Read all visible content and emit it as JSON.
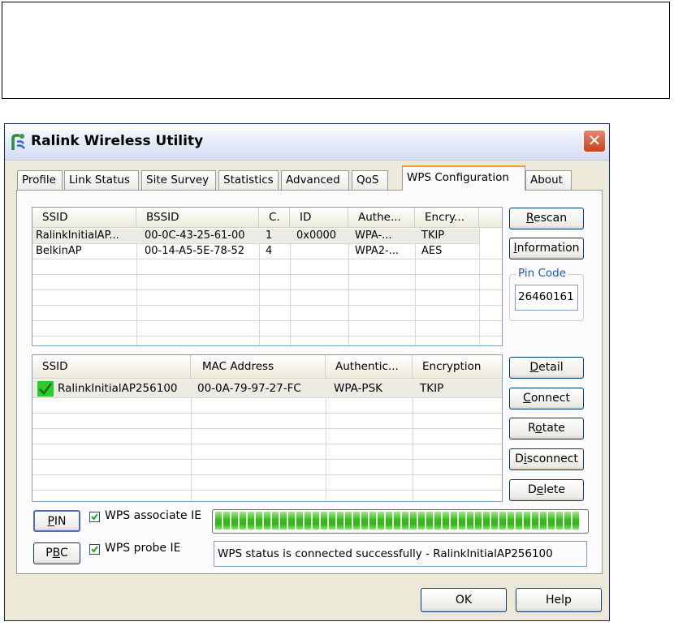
{
  "window": {
    "title": "Ralink Wireless Utility",
    "close_glyph": "✕"
  },
  "tabs": [
    {
      "label": "Profile"
    },
    {
      "label": "Link Status"
    },
    {
      "label": "Site Survey"
    },
    {
      "label": "Statistics"
    },
    {
      "label": "Advanced"
    },
    {
      "label": "QoS"
    },
    {
      "label": "WPS Configuration"
    },
    {
      "label": "About"
    }
  ],
  "ap_list": {
    "columns": [
      "SSID",
      "BSSID",
      "C.",
      "ID",
      "Authe...",
      "Encry..."
    ],
    "rows": [
      {
        "ssid": "RalinkInitialAP...",
        "bssid": "00-0C-43-25-61-00",
        "channel": "1",
        "id": "0x0000",
        "auth": "WPA-...",
        "encry": "TKIP"
      },
      {
        "ssid": "BelkinAP",
        "bssid": "00-14-A5-5E-78-52",
        "channel": "4",
        "id": "",
        "auth": "WPA2-...",
        "encry": "AES"
      }
    ]
  },
  "profile_list": {
    "columns": [
      "SSID",
      "MAC Address",
      "Authentic...",
      "Encryption"
    ],
    "rows": [
      {
        "ssid": "RalinkInitialAP256100",
        "mac": "00-0A-79-97-27-FC",
        "auth": "WPA-PSK",
        "encryption": "TKIP",
        "connected": true
      }
    ]
  },
  "buttons": {
    "rescan": {
      "prefix": "",
      "hot": "R",
      "rest": "escan"
    },
    "information": {
      "prefix": "",
      "hot": "I",
      "rest": "nformation"
    },
    "detail": {
      "prefix": "",
      "hot": "D",
      "rest": "etail"
    },
    "connect": {
      "prefix": "",
      "hot": "C",
      "rest": "onnect"
    },
    "rotate": {
      "prefix": "R",
      "hot": "o",
      "rest": "tate"
    },
    "disconnect": {
      "prefix": "D",
      "hot": "i",
      "rest": "sconnect"
    },
    "delete": {
      "prefix": "D",
      "hot": "e",
      "rest": "lete"
    },
    "pin": {
      "prefix": "",
      "hot": "P",
      "rest": "IN"
    },
    "pbc": {
      "prefix": "P",
      "hot": "B",
      "rest": "C"
    },
    "ok": "OK",
    "help": "Help"
  },
  "pin_code": {
    "label": "Pin Code",
    "value": "26460161"
  },
  "checkboxes": {
    "associate": {
      "label": "WPS associate IE",
      "checked": true
    },
    "probe": {
      "label": "WPS probe IE",
      "checked": true
    }
  },
  "progress": {
    "value": 1.0
  },
  "status_text": "WPS status is connected successfully - RalinkInitialAP256100",
  "colors": {
    "accent_tab": "#f2a02a",
    "progress_green": "#31c016",
    "close_red": "#c8421f"
  },
  "icons": [
    "ralink-logo-icon",
    "close-icon",
    "connected-check-icon",
    "checkbox-check-icon"
  ]
}
